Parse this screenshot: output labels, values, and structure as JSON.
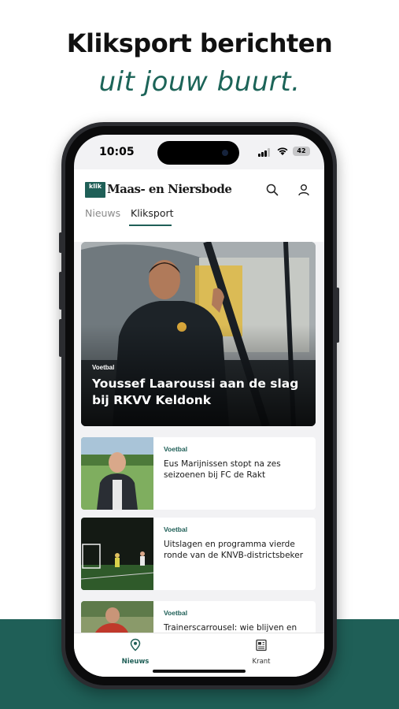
{
  "promo": {
    "headline": "Kliksport berichten",
    "subline": "uit jouw buurt."
  },
  "status_bar": {
    "time": "10:05",
    "battery": "42"
  },
  "header": {
    "logo_badge": "klik",
    "publication": "Maas- en Niersbode",
    "search_icon": "search-icon",
    "account_icon": "user-icon"
  },
  "tabs": [
    {
      "label": "Nieuws",
      "active": false
    },
    {
      "label": "Kliksport",
      "active": true
    }
  ],
  "hero": {
    "category": "Voetbal",
    "title": "Youssef Laaroussi aan de slag bij RKVV Keldonk"
  },
  "articles": [
    {
      "category": "Voetbal",
      "title": "Eus Marijnissen stopt na zes seizoenen bij FC de Rakt"
    },
    {
      "category": "Voetbal",
      "title": "Uitslagen en programma vierde ronde van de KNVB-districtsbeker"
    },
    {
      "category": "Voetbal",
      "title": "Trainerscarrousel: wie blijven en"
    }
  ],
  "bottom_nav": [
    {
      "label": "Nieuws",
      "icon": "map-pin-icon",
      "active": true
    },
    {
      "label": "Krant",
      "icon": "newspaper-icon",
      "active": false
    }
  ],
  "colors": {
    "brand": "#1f5f57",
    "background_band": "#1f5f57"
  }
}
